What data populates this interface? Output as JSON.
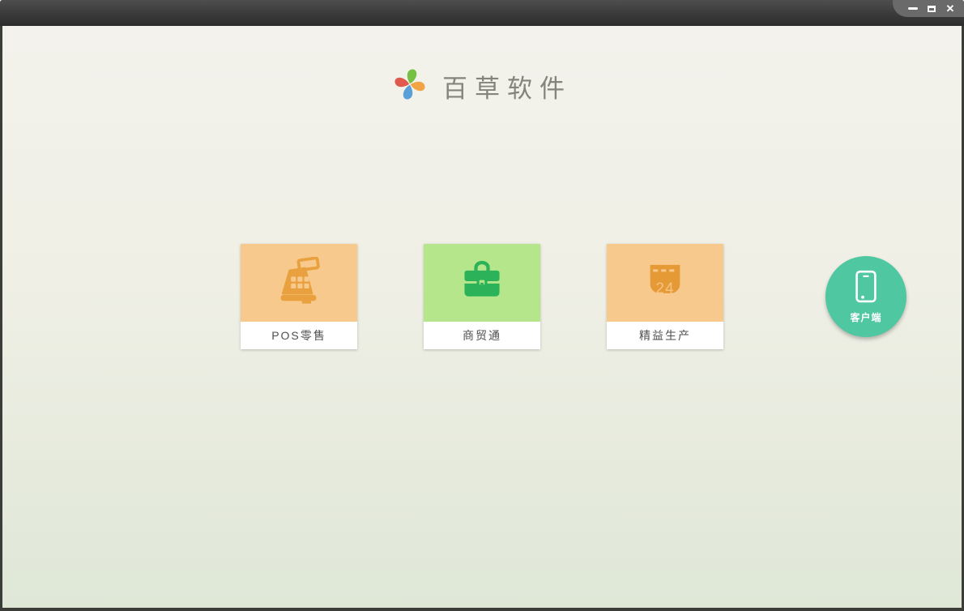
{
  "window": {
    "controls": [
      {
        "name": "minimize"
      },
      {
        "name": "maximize"
      },
      {
        "name": "close",
        "glyph": "✕"
      }
    ],
    "titlebar_color": "#3a3a3a",
    "controls_tab_color": "#6a6a6a"
  },
  "brand": {
    "name": "百草软件",
    "logo": {
      "icon": "pinwheel-logo",
      "petal_colors": {
        "top": "#76c043",
        "right": "#f2a444",
        "bottom": "#5b9fd8",
        "left": "#df5a4d"
      }
    }
  },
  "background": {
    "top_color": "#f3f2ec",
    "bottom_color": "#dfe7d7"
  },
  "products": [
    {
      "label": "POS零售",
      "icon": "cash-register-icon",
      "tile_color": "#f8c98d",
      "icon_color": "#e8a13e"
    },
    {
      "label": "商贸通",
      "icon": "briefcase-icon",
      "tile_color": "#b5e68b",
      "icon_color": "#2cb35a"
    },
    {
      "label": "精益生产",
      "icon": "calendar-icon",
      "tile_color": "#f8c98d",
      "icon_color": "#e59a36",
      "calendar_day": "24"
    }
  ],
  "client_button": {
    "label": "客户端",
    "icon": "smartphone-icon",
    "color": "#4fc7a0"
  }
}
